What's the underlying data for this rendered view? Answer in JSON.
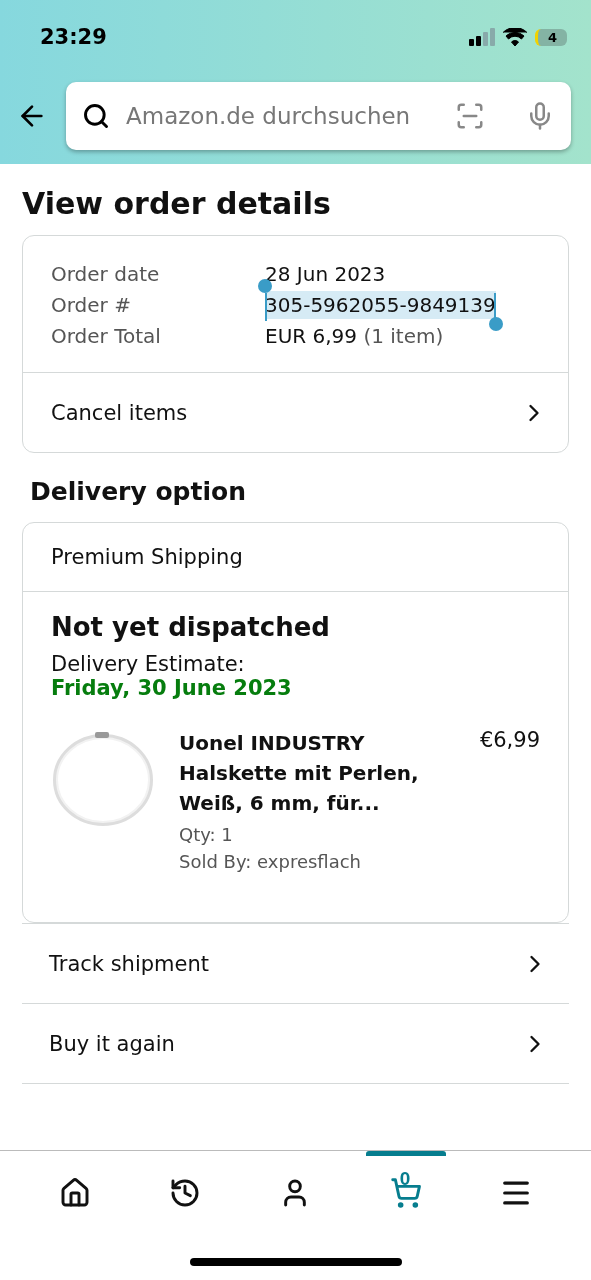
{
  "status_bar": {
    "time": "23:29",
    "battery": "4"
  },
  "search": {
    "placeholder": "Amazon.de durchsuchen"
  },
  "title": "View order details",
  "order_summary": {
    "rows": [
      {
        "label": "Order date",
        "value": "28 Jun 2023",
        "selected": false
      },
      {
        "label": "Order #",
        "value": "305-5962055-9849139",
        "selected": true
      },
      {
        "label": "Order Total",
        "value": "EUR 6,99",
        "note": "(1 item)",
        "selected": false
      }
    ],
    "action": "Cancel items"
  },
  "delivery": {
    "heading": "Delivery option",
    "method": "Premium Shipping",
    "status": "Not yet dispatched",
    "estimate_label": "Delivery Estimate:",
    "estimate_date": "Friday, 30 June 2023",
    "item": {
      "kind": "picture",
      "title": "Uonel INDUSTRY Halskette mit Perlen, Weiß, 6 mm, für...",
      "price": "€6,99",
      "qty": "Qty: 1",
      "seller": "Sold By: expresflach"
    }
  },
  "actions": [
    "Track shipment",
    "Buy it again"
  ],
  "nav": [
    {
      "kind": "home",
      "selected": false
    },
    {
      "kind": "history",
      "selected": false
    },
    {
      "kind": "account",
      "selected": false
    },
    {
      "kind": "cart",
      "selected": true,
      "count": "0"
    },
    {
      "kind": "menu",
      "selected": false
    }
  ]
}
